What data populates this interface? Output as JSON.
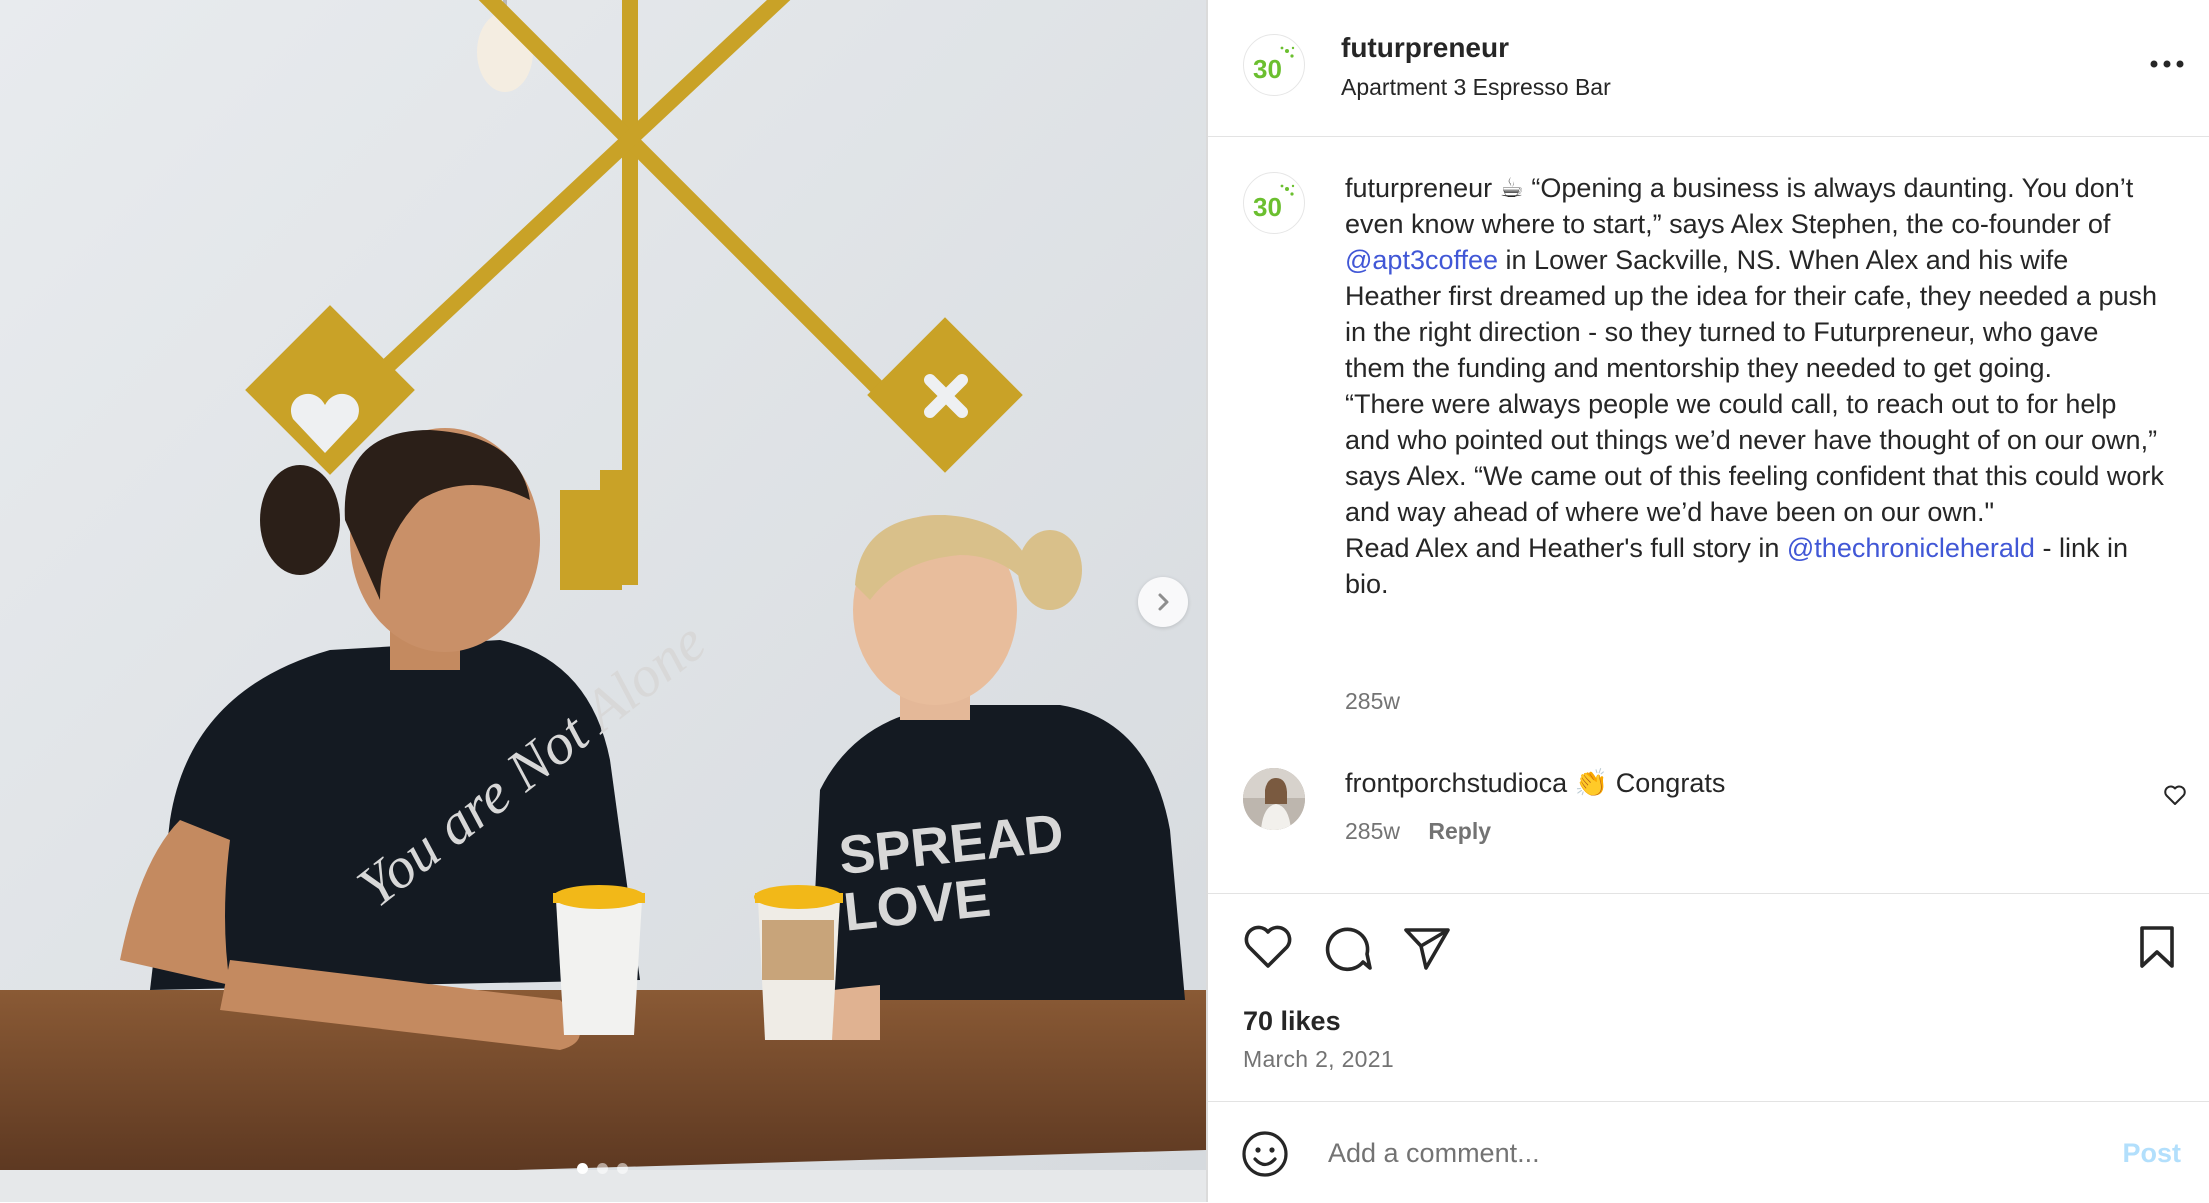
{
  "photo": {
    "shirt_left_text": "You are Not Alone",
    "shirt_right_text": [
      "SPREAD",
      "LOVE"
    ],
    "carousel": {
      "count": 3,
      "active": 1
    }
  },
  "header": {
    "logo_text": "30",
    "username": "futurpreneur",
    "location": "Apartment 3 Espresso Bar"
  },
  "caption": {
    "username": "futurpreneur",
    "emoji": "☕",
    "text_1": " “Opening a business is always daunting. You don’t even know where to start,” says Alex Stephen, the co-founder of ",
    "mention_1": "@apt3coffee",
    "text_2": " in Lower Sackville, NS. When Alex and his wife Heather first dreamed up the idea for their cafe, they needed a push in the right direction - so they turned to Futurpreneur, who gave them the funding and mentorship they needed to get going.\n“There were always people we could call, to reach out to for help and who pointed out things we’d never have thought of on our own,” says Alex. “We came out of this feeling confident that this could work and way ahead of where we’d have been on our own.\"\nRead Alex and Heather's full story in ",
    "mention_2": "@thechronicleherald",
    "text_3": " - link in bio.",
    "time": "285w"
  },
  "comment": {
    "username": "frontporchstudioca",
    "text": "👏 Congrats",
    "time": "285w",
    "reply_label": "Reply"
  },
  "post": {
    "likes": "70 likes",
    "date": "March 2, 2021"
  },
  "composer": {
    "placeholder": "Add a comment...",
    "post_label": "Post"
  },
  "colors": {
    "brand_green": "#6bbf2f",
    "mention_blue": "#4157d6",
    "post_button_disabled": "#b2dffc",
    "gold": "#c9a227"
  }
}
